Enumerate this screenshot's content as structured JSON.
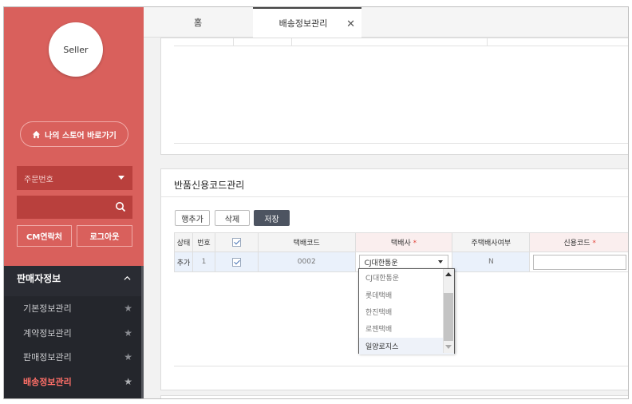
{
  "sidebar": {
    "avatar_text": "Seller",
    "store_button": "나의 스토어 바로가기",
    "order_select": "주문번호",
    "cm_contact": "CM연락처",
    "logout": "로그아웃",
    "menu_title": "판매자정보",
    "items": [
      {
        "label": "기본정보관리"
      },
      {
        "label": "계약정보관리"
      },
      {
        "label": "판매정보관리"
      },
      {
        "label": "배송정보관리"
      }
    ]
  },
  "tabs": {
    "home": "홈",
    "active": "배송정보관리"
  },
  "section": {
    "title": "반품신용코드관리",
    "add_row": "행추가",
    "delete": "삭제",
    "save": "저장"
  },
  "table": {
    "headers": [
      "상태",
      "번호",
      "",
      "택배코드",
      "택배사",
      "주택배사여부",
      "신용코드"
    ],
    "row": {
      "status": "추가",
      "number": "1",
      "code": "0002",
      "courier": "CJ대한통운",
      "main_flag": "N",
      "credit_code": ""
    }
  },
  "dropdown": {
    "options": [
      "CJ대한통운",
      "롯데택배",
      "한진택배",
      "로젠택배",
      "일양로지스"
    ],
    "selected_index": 4
  },
  "colors": {
    "sidebar_bg": "#d9605c",
    "active_menu": "#ff6f68",
    "required_star": "#e2483d",
    "save_button": "#4d5461"
  }
}
